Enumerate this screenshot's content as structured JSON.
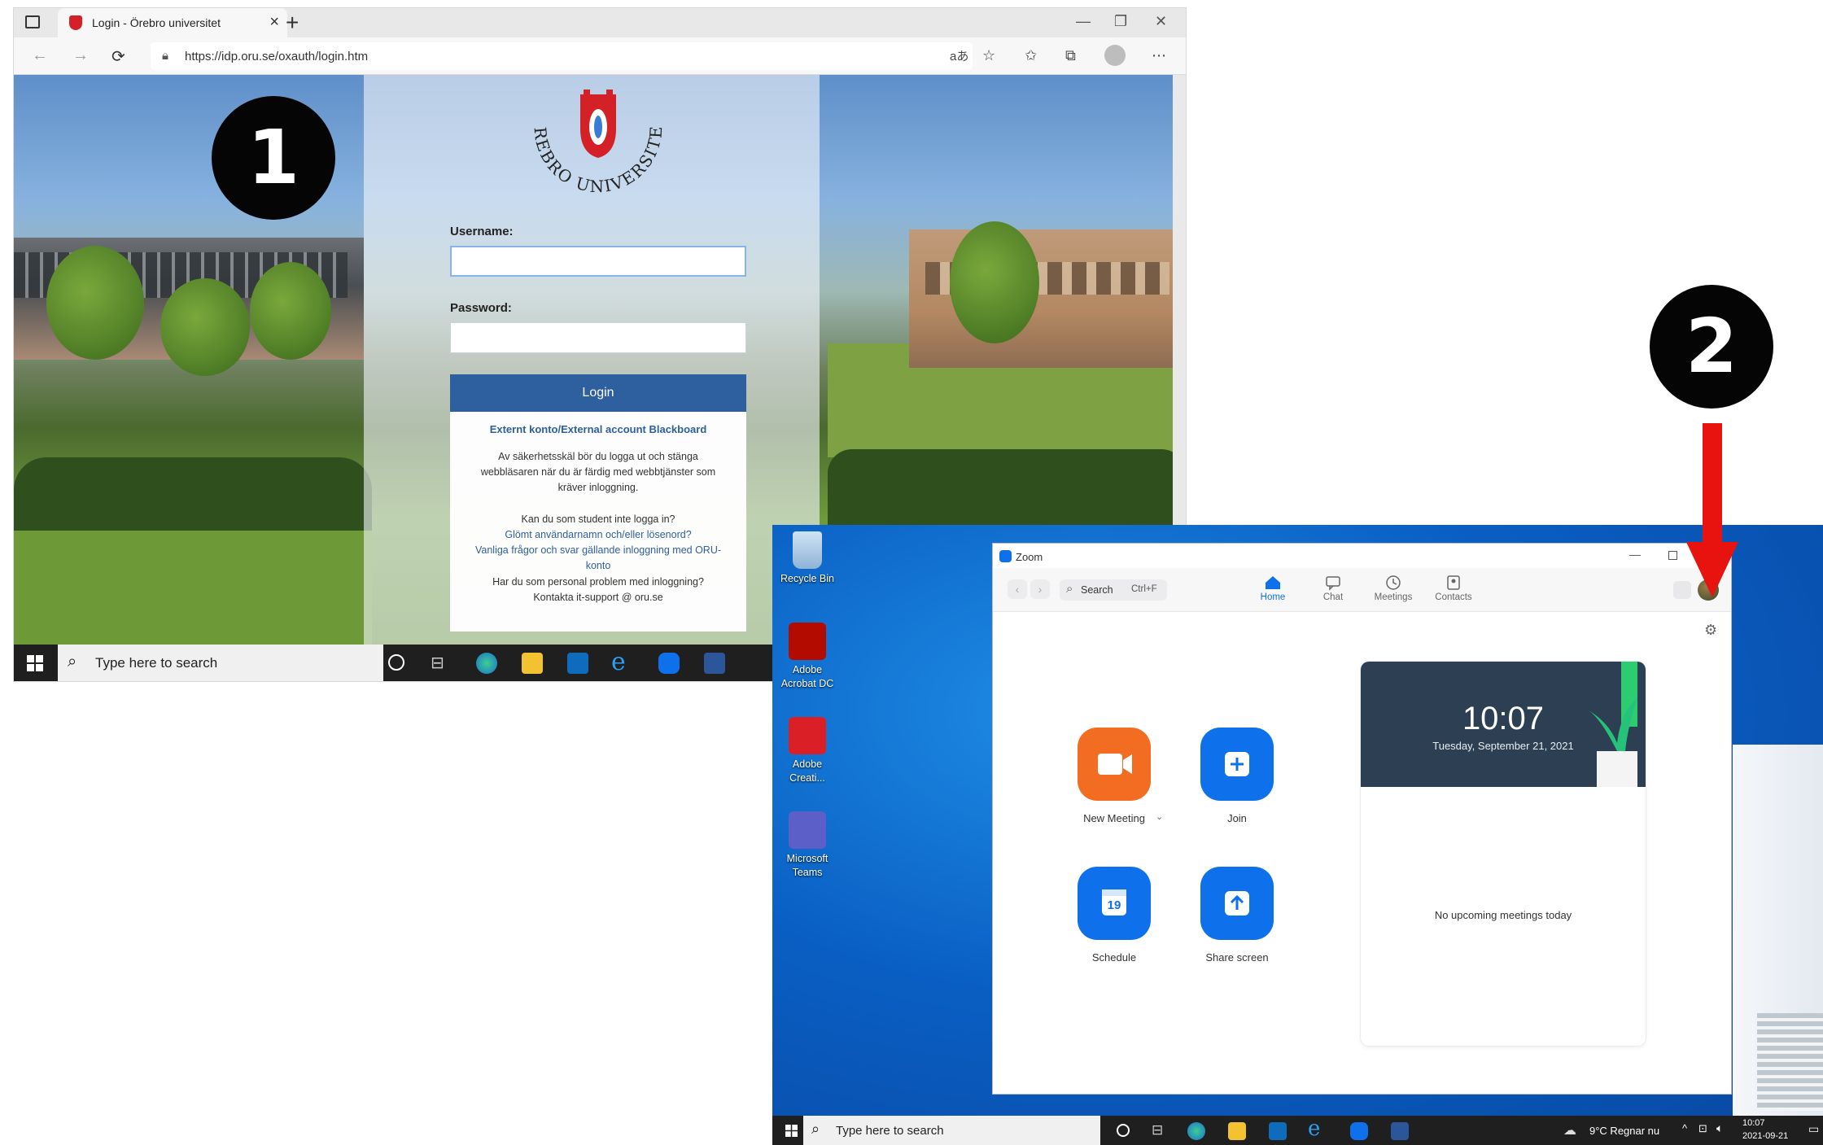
{
  "browser": {
    "tab_title": "Login - Örebro universitet",
    "tab_close": "×",
    "new_tab": "+",
    "url": "https://idp.oru.se/oxauth/login.htm",
    "translate_icon": "aあ"
  },
  "login": {
    "logo_text": "ÖREBRO UNIVERSITET",
    "logo_letters": "ÖREBRO UNIVERSITET",
    "username_label": "Username:",
    "password_label": "Password:",
    "login_button": "Login",
    "external_account": "Externt konto/External account Blackboard",
    "security_notice_1": "Av säkerhetsskäl bör du logga ut och stänga",
    "security_notice_2": "webbläsaren när du är färdig med webbtjänster som",
    "security_notice_3": "kräver inloggning.",
    "student_question": "Kan du som student inte logga in?",
    "forgot_link": "Glömt användarnamn och/eller lösenord?",
    "faq_link_1": "Vanliga frågor och svar gällande inloggning med ORU-",
    "faq_link_2": "konto",
    "staff_question": "Har du som personal problem med inloggning?",
    "contact": "Kontakta it-support @ oru.se"
  },
  "taskbar1": {
    "search_placeholder": "Type here to search"
  },
  "badges": {
    "step1": "1",
    "step2": "2"
  },
  "desktop": {
    "icons": [
      {
        "label_1": "Recycle Bin",
        "label_2": ""
      },
      {
        "label_1": "Adobe",
        "label_2": "Acrobat DC"
      },
      {
        "label_1": "Adobe",
        "label_2": "Creati..."
      },
      {
        "label_1": "Microsoft",
        "label_2": "Teams"
      }
    ]
  },
  "zoom": {
    "window_title": "Zoom",
    "search_label": "Search",
    "search_shortcut": "Ctrl+F",
    "tabs": [
      "Home",
      "Chat",
      "Meetings",
      "Contacts"
    ],
    "new_meeting": "New Meeting",
    "join": "Join",
    "schedule": "Schedule",
    "share_screen": "Share screen",
    "calendar_day": "19",
    "clock": "10:07",
    "date": "Tuesday, September 21, 2021",
    "no_meetings": "No upcoming meetings today",
    "accent_color": "#0e71eb",
    "new_meeting_color": "#f26d21"
  },
  "taskbar2": {
    "search_placeholder": "Type here to search",
    "weather": "9°C  Regnar nu",
    "time": "10:07",
    "date": "2021-09-21"
  },
  "annotation": {
    "arrow_color": "#e8130f"
  }
}
